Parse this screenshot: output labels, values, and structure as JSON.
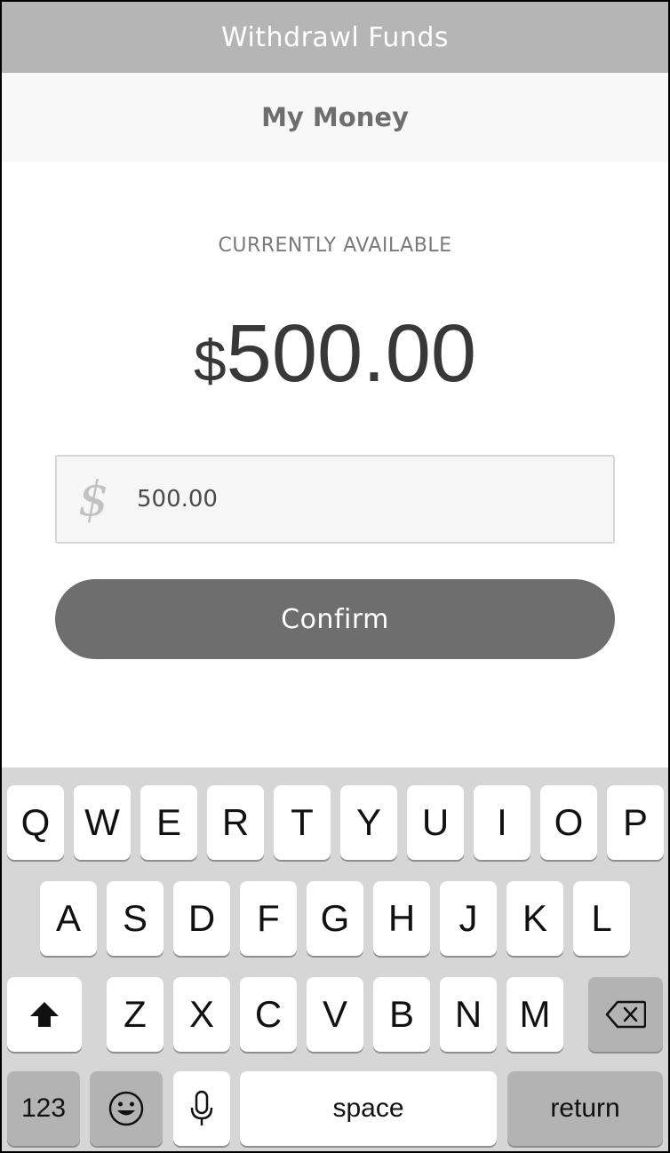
{
  "header": {
    "title": "Withdrawl Funds"
  },
  "subheader": {
    "title": "My Money"
  },
  "balance": {
    "label": "CURRENTLY AVAILABLE",
    "currency_symbol": "$",
    "amount": "500.00"
  },
  "amount_input": {
    "currency_symbol": "$",
    "value": "500.00"
  },
  "confirm_button": {
    "label": "Confirm"
  },
  "keyboard": {
    "row1": [
      "Q",
      "W",
      "E",
      "R",
      "T",
      "Y",
      "U",
      "I",
      "O",
      "P"
    ],
    "row2": [
      "A",
      "S",
      "D",
      "F",
      "G",
      "H",
      "J",
      "K",
      "L"
    ],
    "row3": [
      "Z",
      "X",
      "C",
      "V",
      "B",
      "N",
      "M"
    ],
    "numbers_key": "123",
    "space_key": "space",
    "return_key": "return",
    "icons": {
      "shift": "shift-icon",
      "backspace": "backspace-icon",
      "emoji": "emoji-icon",
      "microphone": "microphone-icon"
    }
  },
  "colors": {
    "header_bg": "#b5b5b5",
    "button_bg": "#6e6e6e",
    "keyboard_bg": "#d6d6d6"
  }
}
